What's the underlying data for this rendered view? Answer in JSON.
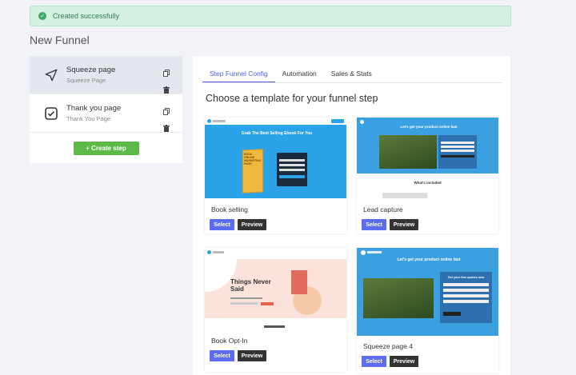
{
  "alert": {
    "message": "Created successfully"
  },
  "page": {
    "title": "New Funnel"
  },
  "steps": [
    {
      "title": "Squeeze page",
      "subtitle": "Squeeze Page",
      "active": true
    },
    {
      "title": "Thank you page",
      "subtitle": "Thank You Page",
      "active": false
    }
  ],
  "create_step_label": "+ Create step",
  "tabs": [
    {
      "label": "Step Funnel Config",
      "active": true
    },
    {
      "label": "Automation",
      "active": false
    },
    {
      "label": "Sales & Stats",
      "active": false
    }
  ],
  "heading": "Choose a template for your funnel step",
  "templates": [
    {
      "name": "Book selling",
      "select_label": "Select",
      "preview_label": "Preview",
      "thumb": {
        "headline": "Grab The Best Selling Ebook For You",
        "book_text": "BOOK ONLINE MARKETING PAGE"
      }
    },
    {
      "name": "Lead capture",
      "select_label": "Select",
      "preview_label": "Preview",
      "thumb": {
        "headline": "Let's get your product online fast",
        "sub": "What's included"
      }
    },
    {
      "name": "Book Opt-In",
      "select_label": "Select",
      "preview_label": "Preview",
      "thumb": {
        "headline": "Things Never Said"
      }
    },
    {
      "name": "Squeeze page 4",
      "select_label": "Select",
      "preview_label": "Preview",
      "thumb": {
        "headline": "Let's get your product online fast",
        "form_title": "Get your free quotes now"
      }
    }
  ],
  "colors": {
    "accent": "#4b5ce0",
    "success": "#5cb947",
    "alert_bg": "#d4f1e2",
    "select": "#5b6cf0"
  }
}
